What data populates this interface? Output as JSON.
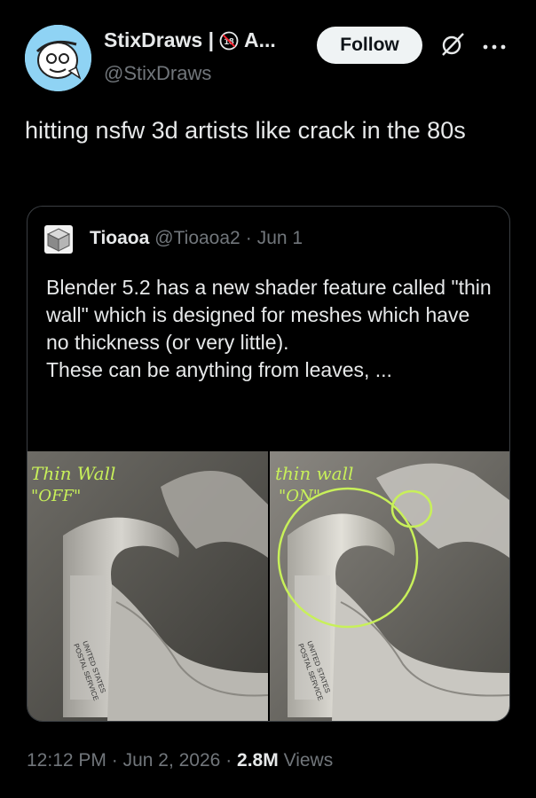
{
  "author": {
    "display_name": "StixDraws | ",
    "display_name_suffix": "A...",
    "badge_text": "18",
    "handle": "@StixDraws",
    "avatar_icon": "doodle-face-avatar"
  },
  "actions": {
    "follow_label": "Follow",
    "grok_icon": "grok-icon",
    "more_icon": "more-icon"
  },
  "tweet": {
    "text": "hitting nsfw 3d artists like crack in the 80s"
  },
  "quote": {
    "name": "Tioaoa",
    "handle": "@Tioaoa2",
    "separator": "·",
    "date": "Jun 1",
    "text_paragraphs": [
      "Blender 5.2 has a new shader feature called \"thin wall\" which is designed for meshes which have no thickness (or very little).",
      "These can be anything from leaves, ..."
    ],
    "images": {
      "left_annotation_line1": "Thin Wall",
      "left_annotation_line2": "\"OFF\"",
      "right_annotation_line1": "thin wall",
      "right_annotation_line2": "\"ON\"",
      "receipt_text_1": "UNITED STATES",
      "receipt_text_2": "POSTAL SERVICE",
      "annotation_color": "#c8f05a"
    }
  },
  "meta": {
    "time": "12:12 PM",
    "dot": "·",
    "date": "Jun 2, 2026",
    "views_count": "2.8M",
    "views_label": "Views"
  }
}
